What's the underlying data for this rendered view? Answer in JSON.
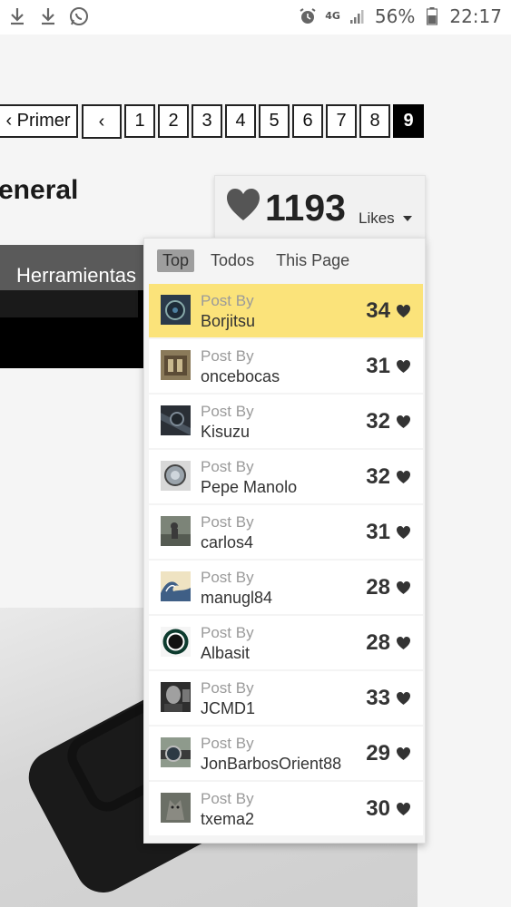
{
  "status_bar": {
    "network": "4G",
    "battery": "56%",
    "time": "22:17",
    "left_icons": [
      "download-icon",
      "download-icon",
      "whatsapp-icon"
    ],
    "right_icons": [
      "alarm-icon",
      "signal-icon",
      "battery-icon"
    ]
  },
  "pagination": {
    "first_label": "‹ Primer",
    "prev_label": "‹",
    "pages": [
      "1",
      "2",
      "3",
      "4",
      "5",
      "6",
      "7",
      "8",
      "9"
    ],
    "active_page": "9"
  },
  "page_title": "eneral",
  "toolbar": {
    "tab_label": "Herramientas"
  },
  "likes": {
    "count": "1193",
    "label": "Likes",
    "heart_color": "#555555"
  },
  "dropdown": {
    "tabs": [
      "Top",
      "Todos",
      "This Page"
    ],
    "active_tab": "Top",
    "highlight_color": "#fbe37a",
    "rows": [
      {
        "post_by": "Post By",
        "user": "Borjitsu",
        "likes": "34",
        "avatar": "watch-dark"
      },
      {
        "post_by": "Post By",
        "user": "oncebocas",
        "likes": "31",
        "avatar": "building"
      },
      {
        "post_by": "Post By",
        "user": "Kisuzu",
        "likes": "32",
        "avatar": "watch-band"
      },
      {
        "post_by": "Post By",
        "user": "Pepe Manolo",
        "likes": "32",
        "avatar": "watch-steel"
      },
      {
        "post_by": "Post By",
        "user": "carlos4",
        "likes": "31",
        "avatar": "person-street"
      },
      {
        "post_by": "Post By",
        "user": "manugl84",
        "likes": "28",
        "avatar": "great-wave"
      },
      {
        "post_by": "Post By",
        "user": "Albasit",
        "likes": "28",
        "avatar": "green-ring"
      },
      {
        "post_by": "Post By",
        "user": "JCMD1",
        "likes": "33",
        "avatar": "portrait"
      },
      {
        "post_by": "Post By",
        "user": "JonBarbosOrient88",
        "likes": "29",
        "avatar": "wrist-watch"
      },
      {
        "post_by": "Post By",
        "user": "txema2",
        "likes": "30",
        "avatar": "wolf"
      }
    ]
  }
}
